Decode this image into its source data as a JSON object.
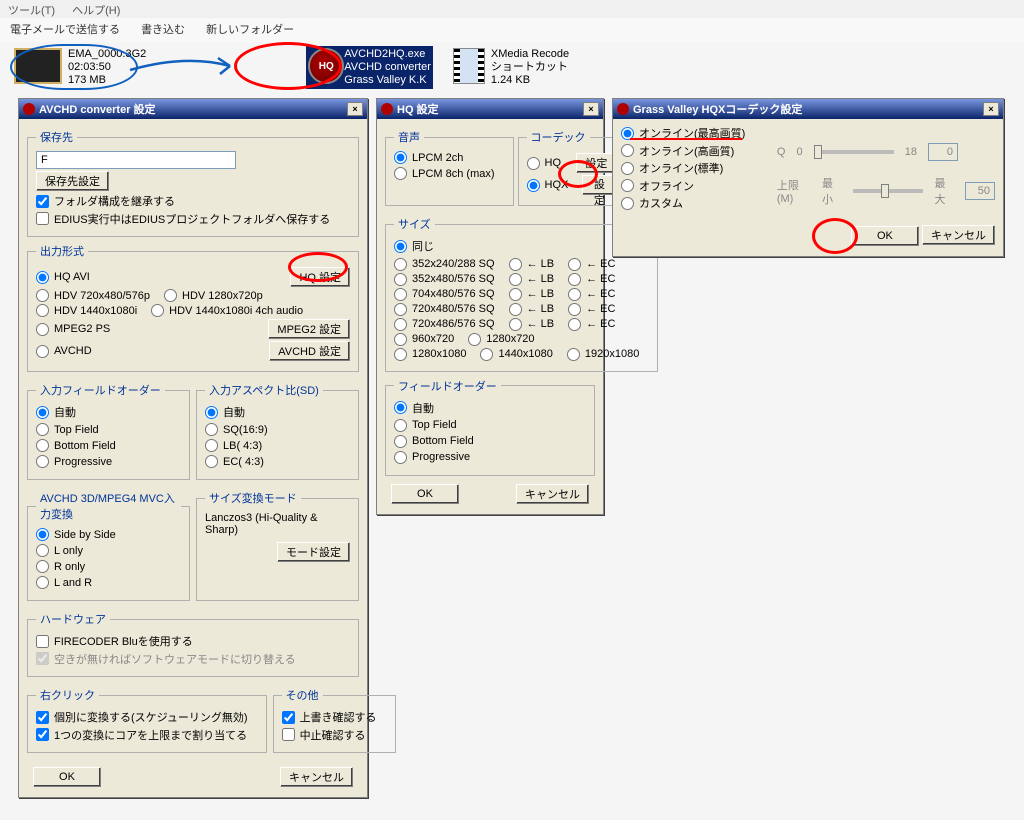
{
  "menubar": {
    "tools": "ツール(T)",
    "help": "ヘルプ(H)"
  },
  "toolbar": {
    "send_mail": "電子メールで送信する",
    "write": "書き込む",
    "new_folder": "新しいフォルダー"
  },
  "files": {
    "video": {
      "name": "EMA_0000.3G2",
      "duration": "02:03:50",
      "size": "173 MB"
    },
    "app": {
      "name": "AVCHD2HQ.exe",
      "desc": "AVCHD converter",
      "vendor": "Grass Valley K.K",
      "icon_text": "HQ"
    },
    "shortcut": {
      "name": "XMedia Recode",
      "type": "ショートカット",
      "size": "1.24 KB"
    }
  },
  "dlg1": {
    "title": "AVCHD converter 設定",
    "close": "×",
    "save": {
      "legend": "保存先",
      "path": "F",
      "btn": "保存先設定",
      "inherit": "フォルダ構成を継承する",
      "edius": "EDIUS実行中はEDIUSプロジェクトフォルダへ保存する"
    },
    "output": {
      "legend": "出力形式",
      "hq_avi": "HQ AVI",
      "hq_btn": "HQ 設定",
      "hdv_sd": "HDV 720x480/576p",
      "hdv_720": "HDV 1280x720p",
      "hdv_1080": "HDV 1440x1080i",
      "hdv_1080_4ch": "HDV 1440x1080i 4ch audio",
      "mpeg2": "MPEG2 PS",
      "mpeg2_btn": "MPEG2 設定",
      "avchd": "AVCHD",
      "avchd_btn": "AVCHD 設定"
    },
    "field_order": {
      "legend": "入力フィールドオーダー",
      "auto": "自動",
      "top": "Top Field",
      "bottom": "Bottom Field",
      "prog": "Progressive"
    },
    "aspect": {
      "legend": "入力アスペクト比(SD)",
      "auto": "自動",
      "sq": "SQ(16:9)",
      "lb": "LB( 4:3)",
      "ec": "EC( 4:3)"
    },
    "mvc": {
      "legend": "AVCHD 3D/MPEG4 MVC入力変換",
      "sbs": "Side by Side",
      "lonly": "L only",
      "ronly": "R only",
      "lr": "L and R"
    },
    "resize": {
      "legend": "サイズ変換モード",
      "label": "Lanczos3 (Hi-Quality & Sharp)",
      "btn": "モード設定"
    },
    "hardware": {
      "legend": "ハードウェア",
      "firecoder": "FIRECODER Bluを使用する",
      "fallback": "空きが無ければソフトウェアモードに切り替える"
    },
    "rightclick": {
      "legend": "右クリック",
      "individual": "個別に変換する(スケジューリング無効)",
      "allocate": "1つの変換にコアを上限まで割り当てる"
    },
    "other": {
      "legend": "その他",
      "confirm_over": "上書き確認する",
      "confirm_abort": "中止確認する"
    },
    "ok": "OK",
    "cancel": "キャンセル"
  },
  "dlg2": {
    "title": "HQ 設定",
    "close": "×",
    "audio": {
      "legend": "音声",
      "lpcm2": "LPCM 2ch",
      "lpcm8": "LPCM 8ch (max)"
    },
    "codec": {
      "legend": "コーデック",
      "hq": "HQ",
      "hqx": "HQX",
      "btn": "設定"
    },
    "size": {
      "legend": "サイズ",
      "same": "同じ",
      "r1": "352x240/288 SQ",
      "r2": "352x480/576 SQ",
      "r3": "704x480/576 SQ",
      "r4": "720x480/576 SQ",
      "r5": "720x486/576 SQ",
      "r6": "960x720",
      "r7": "1280x720",
      "r8": "1280x1080",
      "r9": "1440x1080",
      "r10": "1920x1080",
      "lb": "← LB",
      "ec": "← EC"
    },
    "field_order": {
      "legend": "フィールドオーダー",
      "auto": "自動",
      "top": "Top Field",
      "bottom": "Bottom Field",
      "prog": "Progressive"
    },
    "ok": "OK",
    "cancel": "キャンセル"
  },
  "dlg3": {
    "title": "Grass Valley HQXコーデック設定",
    "close": "×",
    "modes": {
      "best": "オンライン(最高画質)",
      "high": "オンライン(高画質)",
      "std": "オンライン(標準)",
      "offline": "オフライン",
      "custom": "カスタム"
    },
    "q_label": "Q",
    "q_val": "0",
    "q_max": "18",
    "q_field": "0",
    "limit_label": "上限(M)",
    "min": "最小",
    "max": "最大",
    "max_field": "50",
    "ok": "OK",
    "cancel": "キャンセル"
  }
}
